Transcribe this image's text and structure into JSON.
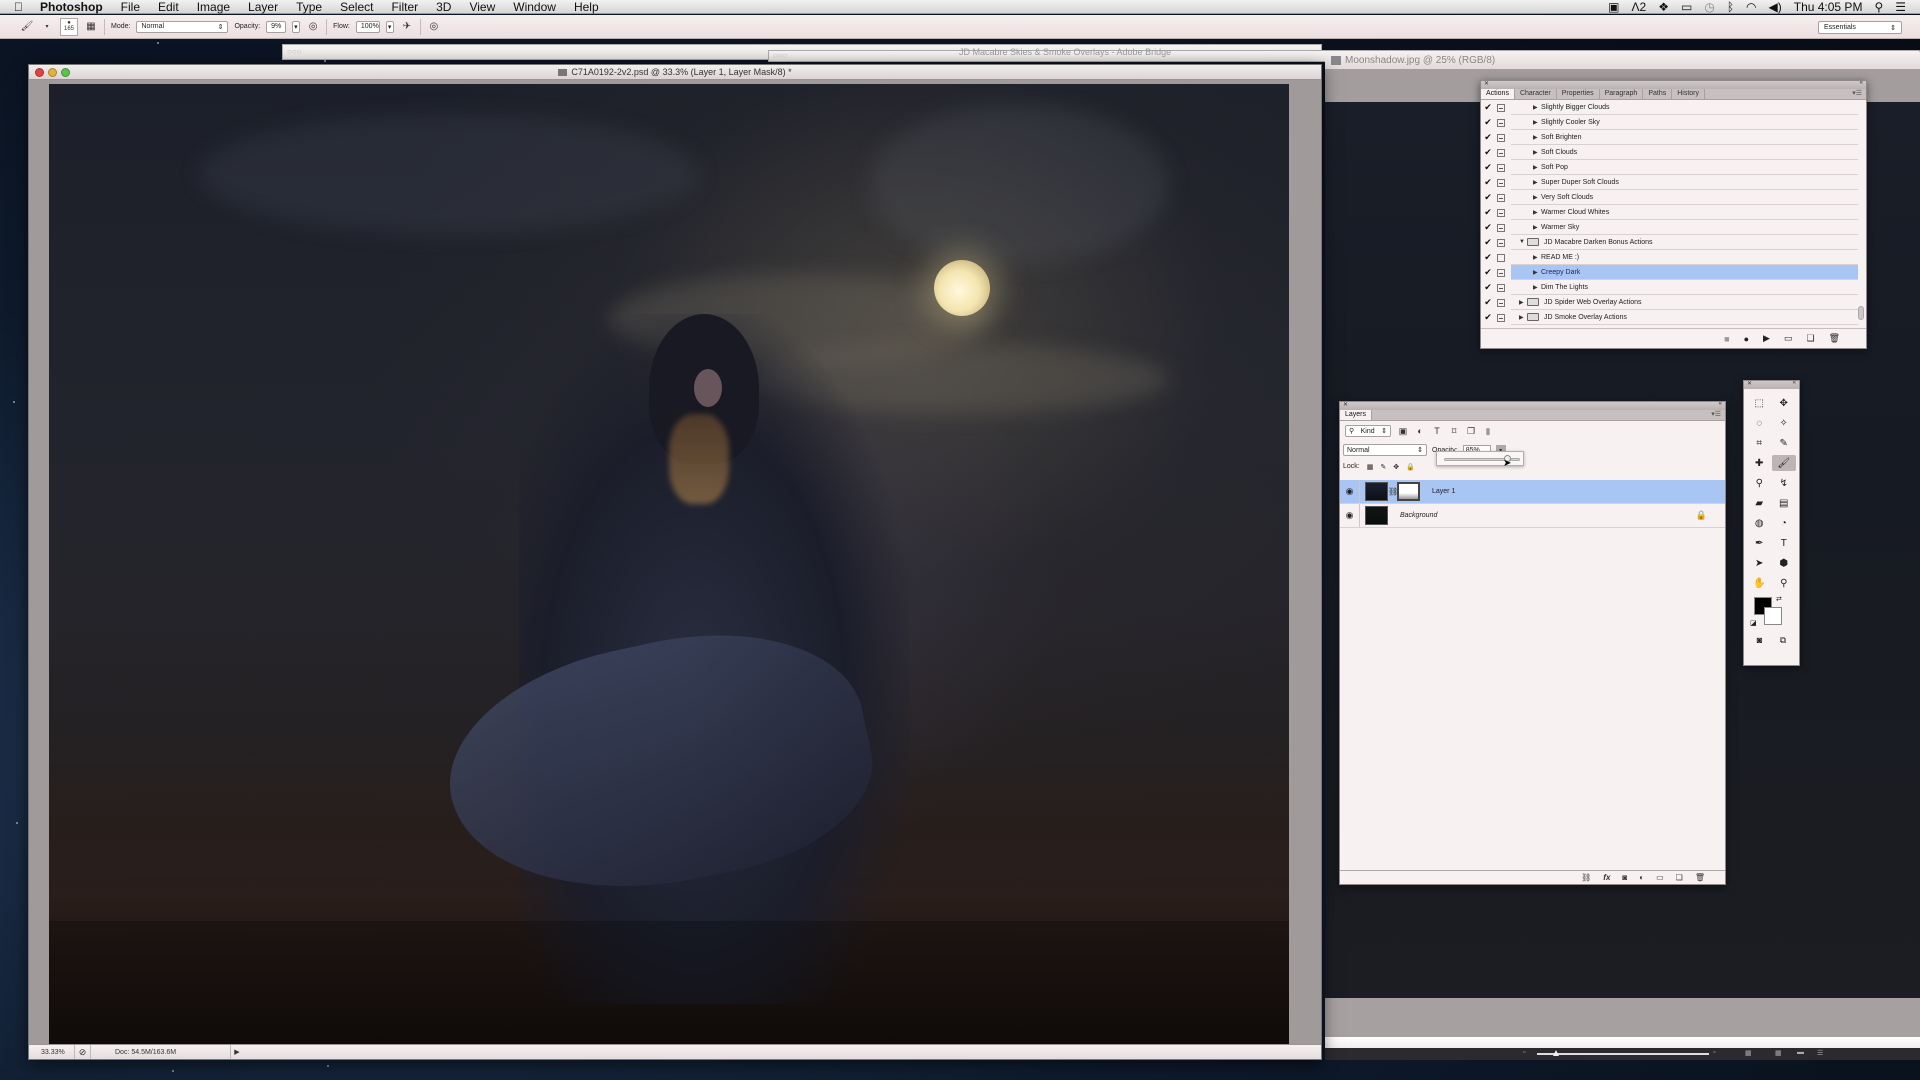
{
  "menubar": {
    "app_name": "Photoshop",
    "items": [
      "File",
      "Edit",
      "Image",
      "Layer",
      "Type",
      "Select",
      "Filter",
      "3D",
      "View",
      "Window",
      "Help"
    ],
    "status_icons": [
      "camera-icon",
      "adobe-icon",
      "dropbox-icon",
      "display-icon",
      "time-machine-icon",
      "bluetooth-icon",
      "wifi-icon",
      "volume-icon"
    ],
    "adobe_badge": "2",
    "clock": "Thu 4:05 PM"
  },
  "options_bar": {
    "brush_size": "165",
    "mode_label": "Mode:",
    "mode_value": "Normal",
    "opacity_label": "Opacity:",
    "opacity_value": "9%",
    "flow_label": "Flow:",
    "flow_value": "100%",
    "workspace": "Essentials"
  },
  "bridge_window": {
    "title": "JD Macabre Skies & Smoke Overlays - Adobe Bridge"
  },
  "document": {
    "title": "C71A0192-2v2.psd @ 33.3% (Layer 1, Layer Mask/8) *",
    "zoom": "33.33%",
    "doc_size": "Doc: 54.5M/163.6M"
  },
  "moonshadow_window": {
    "title": "Moonshadow.jpg @ 25% (RGB/8)"
  },
  "actions_panel": {
    "tabs": [
      "Actions",
      "Character",
      "Properties",
      "Paragraph",
      "Paths",
      "History"
    ],
    "active_tab": "Actions",
    "items": [
      {
        "label": "Slightly Bigger Clouds",
        "type": "action",
        "level": 1,
        "checked": true,
        "dialog": true
      },
      {
        "label": "Slightly Cooler Sky",
        "type": "action",
        "level": 1,
        "checked": true,
        "dialog": true
      },
      {
        "label": "Soft Brighten",
        "type": "action",
        "level": 1,
        "checked": true,
        "dialog": true
      },
      {
        "label": "Soft Clouds",
        "type": "action",
        "level": 1,
        "checked": true,
        "dialog": true
      },
      {
        "label": "Soft Pop",
        "type": "action",
        "level": 1,
        "checked": true,
        "dialog": true
      },
      {
        "label": "Super Duper Soft Clouds",
        "type": "action",
        "level": 1,
        "checked": true,
        "dialog": true
      },
      {
        "label": "Very Soft Clouds",
        "type": "action",
        "level": 1,
        "checked": true,
        "dialog": true
      },
      {
        "label": "Warmer Cloud Whites",
        "type": "action",
        "level": 1,
        "checked": true,
        "dialog": true
      },
      {
        "label": "Warmer Sky",
        "type": "action",
        "level": 1,
        "checked": true,
        "dialog": true
      },
      {
        "label": "JD Macabre Darken Bonus Actions",
        "type": "set-open",
        "level": 0,
        "checked": true,
        "dialog": true
      },
      {
        "label": "READ ME :)",
        "type": "action",
        "level": 1,
        "checked": true,
        "dialog": false
      },
      {
        "label": "Creepy Dark",
        "type": "action",
        "level": 1,
        "checked": true,
        "dialog": true,
        "selected": true
      },
      {
        "label": "Dim The Lights",
        "type": "action",
        "level": 1,
        "checked": true,
        "dialog": true
      },
      {
        "label": "JD Spider Web Overlay Actions",
        "type": "set",
        "level": 0,
        "checked": true,
        "dialog": true
      },
      {
        "label": "JD Smoke Overlay Actions",
        "type": "set",
        "level": 0,
        "checked": true,
        "dialog": true
      }
    ],
    "footer_buttons": [
      "stop-icon",
      "record-icon",
      "play-icon",
      "new-set-icon",
      "new-action-icon",
      "trash-icon"
    ]
  },
  "layers_panel": {
    "tab": "Layers",
    "filter_kind": "Kind",
    "blend_mode": "Normal",
    "opacity_label": "Opacity:",
    "opacity_value": "85%",
    "opacity_fraction": 0.85,
    "lock_label": "Lock:",
    "layers": [
      {
        "name": "Layer 1",
        "visible": true,
        "selected": true,
        "has_mask": true,
        "locked": false
      },
      {
        "name": "Background",
        "visible": true,
        "selected": false,
        "has_mask": false,
        "locked": true
      }
    ],
    "footer_buttons": [
      "link-icon",
      "fx-icon",
      "mask-icon",
      "adjustment-icon",
      "group-icon",
      "new-layer-icon",
      "trash-icon"
    ]
  },
  "tools_panel": {
    "tools": [
      {
        "name": "marquee",
        "glyph": "⬚"
      },
      {
        "name": "move",
        "glyph": "✥"
      },
      {
        "name": "lasso",
        "glyph": "◌"
      },
      {
        "name": "magic-wand",
        "glyph": "✧"
      },
      {
        "name": "crop",
        "glyph": "⌗"
      },
      {
        "name": "eyedropper",
        "glyph": "✎"
      },
      {
        "name": "healing",
        "glyph": "✚"
      },
      {
        "name": "brush",
        "glyph": "🖌",
        "active": true
      },
      {
        "name": "clone-stamp",
        "glyph": "⚲"
      },
      {
        "name": "history-brush",
        "glyph": "↯"
      },
      {
        "name": "eraser",
        "glyph": "▰"
      },
      {
        "name": "gradient",
        "glyph": "▤"
      },
      {
        "name": "blur",
        "glyph": "◍"
      },
      {
        "name": "dodge",
        "glyph": "◔"
      },
      {
        "name": "pen",
        "glyph": "✒"
      },
      {
        "name": "type",
        "glyph": "T"
      },
      {
        "name": "path-selection",
        "glyph": "➤"
      },
      {
        "name": "shape",
        "glyph": "⬢"
      },
      {
        "name": "hand",
        "glyph": "✋"
      },
      {
        "name": "zoom",
        "glyph": "⚲"
      }
    ],
    "foreground_color": "#000000",
    "background_color": "#ffffff"
  }
}
